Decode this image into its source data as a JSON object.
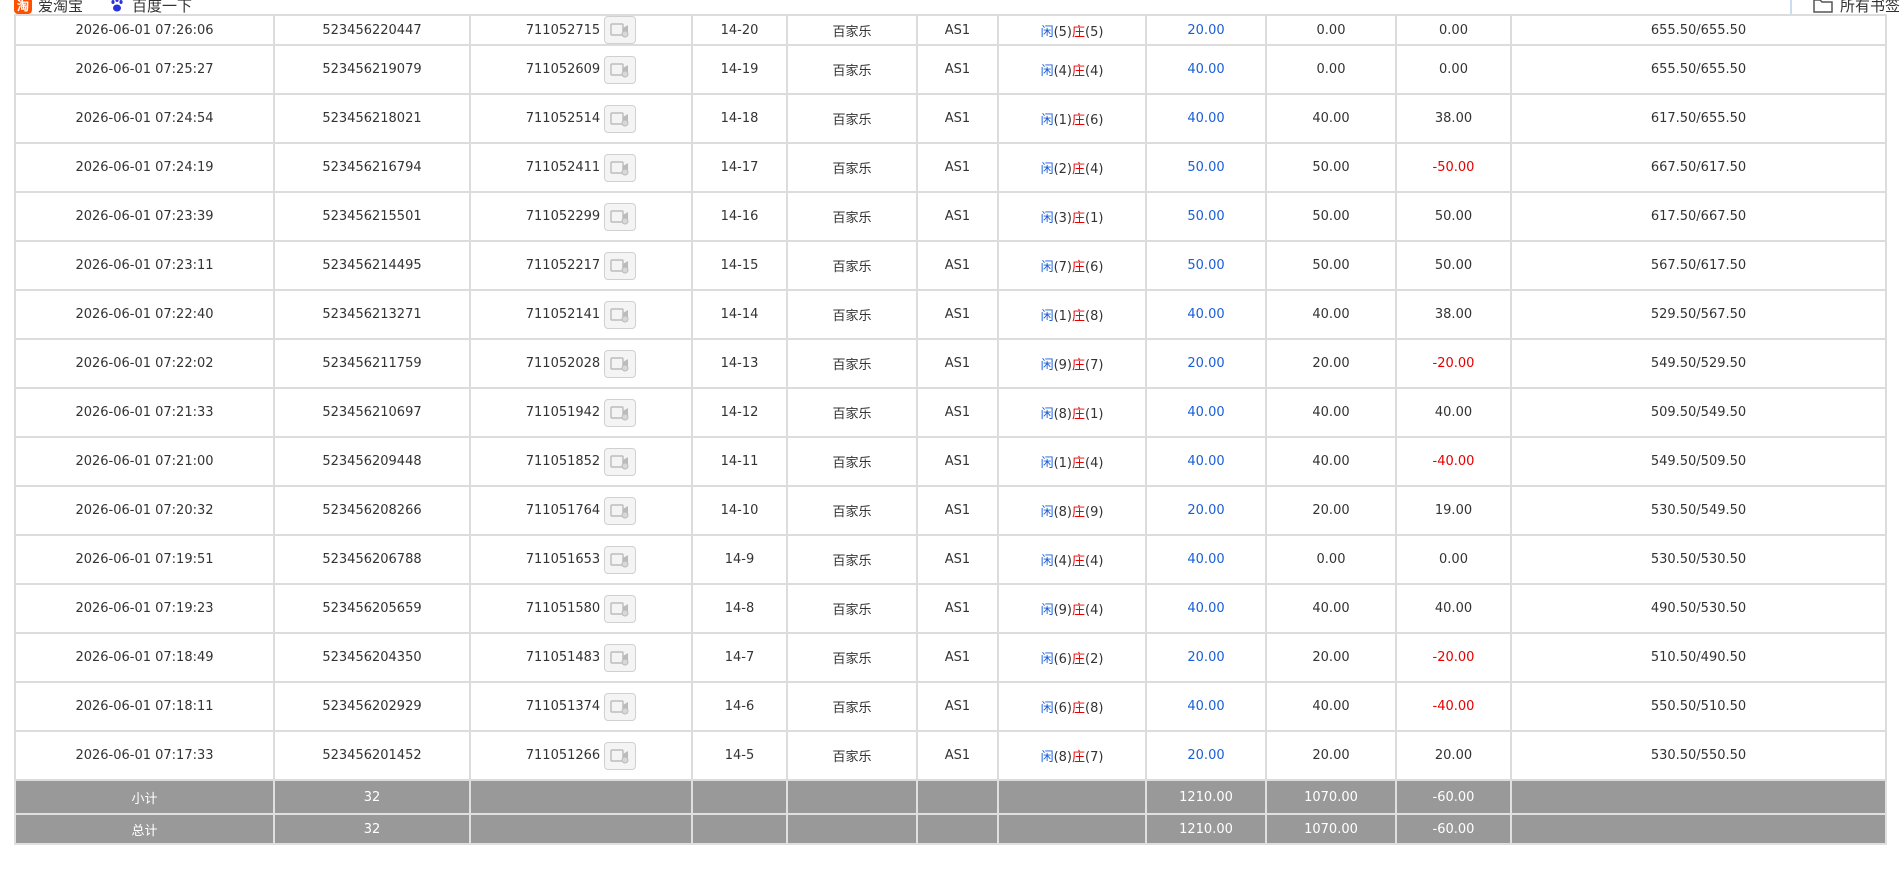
{
  "bookmarks": {
    "taobao_icon_char": "淘",
    "taobao_label": "爱淘宝",
    "baidu_label": "百度一下",
    "all_label": "所有书签"
  },
  "colors": {
    "blue": "#1a5fd8",
    "red": "#e60000",
    "summary_bg": "#999999"
  },
  "rows": [
    {
      "time": "2026-06-01 07:26:06",
      "order": "523456220447",
      "round": "711052715",
      "shoe": "14-20",
      "game": "百家乐",
      "table": "AS1",
      "result": {
        "p_label": "闲",
        "p": "(5)",
        "b_label": "庄",
        "b": "(5)"
      },
      "bet": "20.00",
      "valid": "0.00",
      "win": "0.00",
      "win_neg": false,
      "balance": "655.50/655.50"
    },
    {
      "time": "2026-06-01 07:25:27",
      "order": "523456219079",
      "round": "711052609",
      "shoe": "14-19",
      "game": "百家乐",
      "table": "AS1",
      "result": {
        "p_label": "闲",
        "p": "(4)",
        "b_label": "庄",
        "b": "(4)"
      },
      "bet": "40.00",
      "valid": "0.00",
      "win": "0.00",
      "win_neg": false,
      "balance": "655.50/655.50"
    },
    {
      "time": "2026-06-01 07:24:54",
      "order": "523456218021",
      "round": "711052514",
      "shoe": "14-18",
      "game": "百家乐",
      "table": "AS1",
      "result": {
        "p_label": "闲",
        "p": "(1)",
        "b_label": "庄",
        "b": "(6)"
      },
      "bet": "40.00",
      "valid": "40.00",
      "win": "38.00",
      "win_neg": false,
      "balance": "617.50/655.50"
    },
    {
      "time": "2026-06-01 07:24:19",
      "order": "523456216794",
      "round": "711052411",
      "shoe": "14-17",
      "game": "百家乐",
      "table": "AS1",
      "result": {
        "p_label": "闲",
        "p": "(2)",
        "b_label": "庄",
        "b": "(4)"
      },
      "bet": "50.00",
      "valid": "50.00",
      "win": "-50.00",
      "win_neg": true,
      "balance": "667.50/617.50"
    },
    {
      "time": "2026-06-01 07:23:39",
      "order": "523456215501",
      "round": "711052299",
      "shoe": "14-16",
      "game": "百家乐",
      "table": "AS1",
      "result": {
        "p_label": "闲",
        "p": "(3)",
        "b_label": "庄",
        "b": "(1)"
      },
      "bet": "50.00",
      "valid": "50.00",
      "win": "50.00",
      "win_neg": false,
      "balance": "617.50/667.50"
    },
    {
      "time": "2026-06-01 07:23:11",
      "order": "523456214495",
      "round": "711052217",
      "shoe": "14-15",
      "game": "百家乐",
      "table": "AS1",
      "result": {
        "p_label": "闲",
        "p": "(7)",
        "b_label": "庄",
        "b": "(6)"
      },
      "bet": "50.00",
      "valid": "50.00",
      "win": "50.00",
      "win_neg": false,
      "balance": "567.50/617.50"
    },
    {
      "time": "2026-06-01 07:22:40",
      "order": "523456213271",
      "round": "711052141",
      "shoe": "14-14",
      "game": "百家乐",
      "table": "AS1",
      "result": {
        "p_label": "闲",
        "p": "(1)",
        "b_label": "庄",
        "b": "(8)"
      },
      "bet": "40.00",
      "valid": "40.00",
      "win": "38.00",
      "win_neg": false,
      "balance": "529.50/567.50"
    },
    {
      "time": "2026-06-01 07:22:02",
      "order": "523456211759",
      "round": "711052028",
      "shoe": "14-13",
      "game": "百家乐",
      "table": "AS1",
      "result": {
        "p_label": "闲",
        "p": "(9)",
        "b_label": "庄",
        "b": "(7)"
      },
      "bet": "20.00",
      "valid": "20.00",
      "win": "-20.00",
      "win_neg": true,
      "balance": "549.50/529.50"
    },
    {
      "time": "2026-06-01 07:21:33",
      "order": "523456210697",
      "round": "711051942",
      "shoe": "14-12",
      "game": "百家乐",
      "table": "AS1",
      "result": {
        "p_label": "闲",
        "p": "(8)",
        "b_label": "庄",
        "b": "(1)"
      },
      "bet": "40.00",
      "valid": "40.00",
      "win": "40.00",
      "win_neg": false,
      "balance": "509.50/549.50"
    },
    {
      "time": "2026-06-01 07:21:00",
      "order": "523456209448",
      "round": "711051852",
      "shoe": "14-11",
      "game": "百家乐",
      "table": "AS1",
      "result": {
        "p_label": "闲",
        "p": "(1)",
        "b_label": "庄",
        "b": "(4)"
      },
      "bet": "40.00",
      "valid": "40.00",
      "win": "-40.00",
      "win_neg": true,
      "balance": "549.50/509.50"
    },
    {
      "time": "2026-06-01 07:20:32",
      "order": "523456208266",
      "round": "711051764",
      "shoe": "14-10",
      "game": "百家乐",
      "table": "AS1",
      "result": {
        "p_label": "闲",
        "p": "(8)",
        "b_label": "庄",
        "b": "(9)"
      },
      "bet": "20.00",
      "valid": "20.00",
      "win": "19.00",
      "win_neg": false,
      "balance": "530.50/549.50"
    },
    {
      "time": "2026-06-01 07:19:51",
      "order": "523456206788",
      "round": "711051653",
      "shoe": "14-9",
      "game": "百家乐",
      "table": "AS1",
      "result": {
        "p_label": "闲",
        "p": "(4)",
        "b_label": "庄",
        "b": "(4)"
      },
      "bet": "40.00",
      "valid": "0.00",
      "win": "0.00",
      "win_neg": false,
      "balance": "530.50/530.50"
    },
    {
      "time": "2026-06-01 07:19:23",
      "order": "523456205659",
      "round": "711051580",
      "shoe": "14-8",
      "game": "百家乐",
      "table": "AS1",
      "result": {
        "p_label": "闲",
        "p": "(9)",
        "b_label": "庄",
        "b": "(4)"
      },
      "bet": "40.00",
      "valid": "40.00",
      "win": "40.00",
      "win_neg": false,
      "balance": "490.50/530.50"
    },
    {
      "time": "2026-06-01 07:18:49",
      "order": "523456204350",
      "round": "711051483",
      "shoe": "14-7",
      "game": "百家乐",
      "table": "AS1",
      "result": {
        "p_label": "闲",
        "p": "(6)",
        "b_label": "庄",
        "b": "(2)"
      },
      "bet": "20.00",
      "valid": "20.00",
      "win": "-20.00",
      "win_neg": true,
      "balance": "510.50/490.50"
    },
    {
      "time": "2026-06-01 07:18:11",
      "order": "523456202929",
      "round": "711051374",
      "shoe": "14-6",
      "game": "百家乐",
      "table": "AS1",
      "result": {
        "p_label": "闲",
        "p": "(6)",
        "b_label": "庄",
        "b": "(8)"
      },
      "bet": "40.00",
      "valid": "40.00",
      "win": "-40.00",
      "win_neg": true,
      "balance": "550.50/510.50"
    },
    {
      "time": "2026-06-01 07:17:33",
      "order": "523456201452",
      "round": "711051266",
      "shoe": "14-5",
      "game": "百家乐",
      "table": "AS1",
      "result": {
        "p_label": "闲",
        "p": "(8)",
        "b_label": "庄",
        "b": "(7)"
      },
      "bet": "20.00",
      "valid": "20.00",
      "win": "20.00",
      "win_neg": false,
      "balance": "530.50/550.50"
    }
  ],
  "subtotal": {
    "label": "小计",
    "count": "32",
    "bet": "1210.00",
    "valid": "1070.00",
    "win": "-60.00"
  },
  "total": {
    "label": "总计",
    "count": "32",
    "bet": "1210.00",
    "valid": "1070.00",
    "win": "-60.00"
  }
}
